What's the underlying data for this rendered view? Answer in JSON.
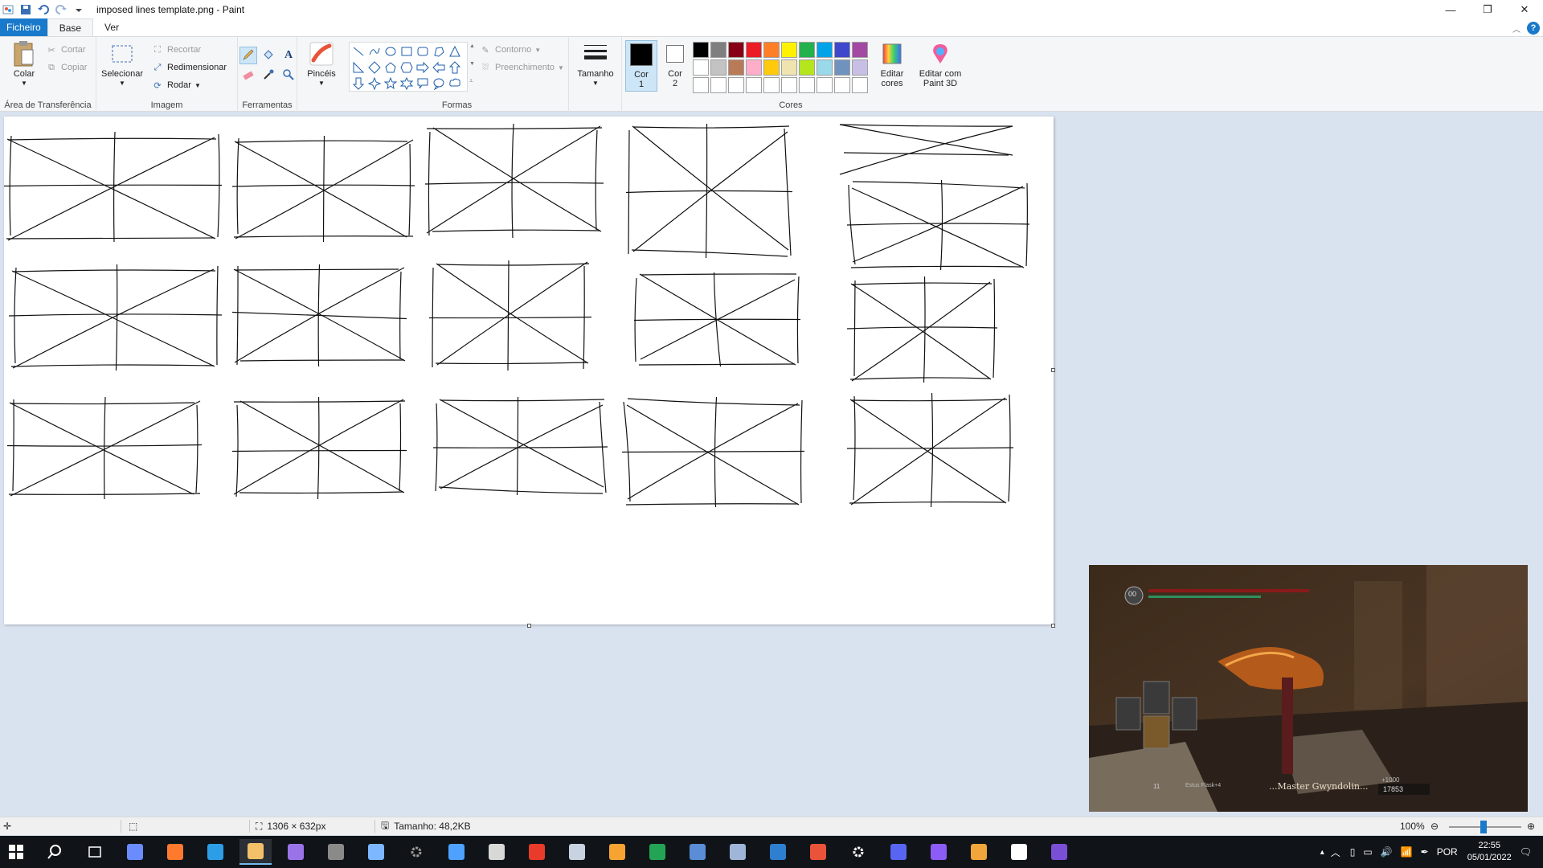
{
  "window": {
    "title": "imposed lines template.png - Paint",
    "controls": [
      "minimize-icon",
      "restore-icon",
      "close-icon"
    ]
  },
  "tabs": [
    {
      "label": "Ficheiro",
      "kind": "file"
    },
    {
      "label": "Base",
      "kind": "active"
    },
    {
      "label": "Ver",
      "kind": "normal"
    }
  ],
  "ribbon": {
    "clipboard": {
      "paste": "Colar",
      "cut": "Cortar",
      "copy": "Copiar",
      "group": "Área de Transferência"
    },
    "image": {
      "select": "Selecionar",
      "crop": "Recortar",
      "resize": "Redimensionar",
      "rotate": "Rodar",
      "group": "Imagem"
    },
    "tools": {
      "group": "Ferramentas"
    },
    "brushes": {
      "label": "Pincéis"
    },
    "shapes": {
      "outline": "Contorno",
      "fill": "Preenchimento",
      "group": "Formas"
    },
    "size": {
      "label": "Tamanho"
    },
    "colors": {
      "color1": "Cor\n1",
      "color1_label_a": "Cor",
      "color1_label_b": "1",
      "color2_label_a": "Cor",
      "color2_label_b": "2",
      "edit_a": "Editar",
      "edit_b": "cores",
      "paint3d_a": "Editar com",
      "paint3d_b": "Paint 3D",
      "group": "Cores",
      "color1_value": "#000000",
      "color2_value": "#ffffff",
      "palette": [
        "#000000",
        "#7f7f7f",
        "#880015",
        "#ed1c24",
        "#ff7f27",
        "#fff200",
        "#22b14c",
        "#00a2e8",
        "#3f48cc",
        "#a349a4",
        "#ffffff",
        "#c3c3c3",
        "#b97a57",
        "#ffaec9",
        "#ffc90e",
        "#efe4b0",
        "#b5e61d",
        "#99d9ea",
        "#7092be",
        "#c8bfe7",
        "#ffffff",
        "#ffffff",
        "#ffffff",
        "#ffffff",
        "#ffffff",
        "#ffffff",
        "#ffffff",
        "#ffffff",
        "#ffffff",
        "#ffffff"
      ]
    }
  },
  "game": {
    "caption": "...Master Gwyndolin...",
    "souls": "17853",
    "souls_gain": "+1000",
    "level_badge": "00",
    "item_count": "11",
    "item_name": "Estus Flask+4"
  },
  "statusbar": {
    "dimensions": "1306 × 632px",
    "size": "Tamanho: 48,2KB",
    "zoom": "100%"
  },
  "taskbar": {
    "lang": "POR",
    "time": "22:55",
    "date": "05/01/2022",
    "apps": [
      {
        "name": "start-icon",
        "color": "#ffffff"
      },
      {
        "name": "search-icon",
        "color": "#ffffff"
      },
      {
        "name": "task-view-icon",
        "color": "#ffffff"
      },
      {
        "name": "app-icon-1",
        "color": "#6b8cff"
      },
      {
        "name": "app-icon-2",
        "color": "#ff7a2e"
      },
      {
        "name": "app-icon-3",
        "color": "#2c9ee8"
      },
      {
        "name": "paint-icon",
        "color": "#f4c06a"
      },
      {
        "name": "app-icon-5",
        "color": "#9b73e8"
      },
      {
        "name": "app-icon-6",
        "color": "#8a8a8a"
      },
      {
        "name": "app-icon-7",
        "color": "#7cb7ff"
      },
      {
        "name": "settings-gear-icon",
        "color": "#9a9a9a"
      },
      {
        "name": "app-icon-9",
        "color": "#4ea1ff"
      },
      {
        "name": "app-icon-10",
        "color": "#d8d8d8"
      },
      {
        "name": "app-icon-11",
        "color": "#e83b2a"
      },
      {
        "name": "app-icon-12",
        "color": "#c8d2e0"
      },
      {
        "name": "app-icon-13",
        "color": "#f7a331"
      },
      {
        "name": "app-icon-14",
        "color": "#23a455"
      },
      {
        "name": "app-icon-15",
        "color": "#5a8dd6"
      },
      {
        "name": "camera-icon",
        "color": "#9fb6d9"
      },
      {
        "name": "app-icon-17",
        "color": "#2f7fd0"
      },
      {
        "name": "app-icon-18",
        "color": "#e8533a"
      },
      {
        "name": "settings-icon",
        "color": "#ffffff"
      },
      {
        "name": "app-icon-20",
        "color": "#5865f2"
      },
      {
        "name": "github-icon",
        "color": "#8b5cf6"
      },
      {
        "name": "app-icon-22",
        "color": "#f2a53b"
      },
      {
        "name": "file-icon",
        "color": "#ffffff"
      },
      {
        "name": "app-icon-24",
        "color": "#7a4fd6"
      }
    ]
  }
}
